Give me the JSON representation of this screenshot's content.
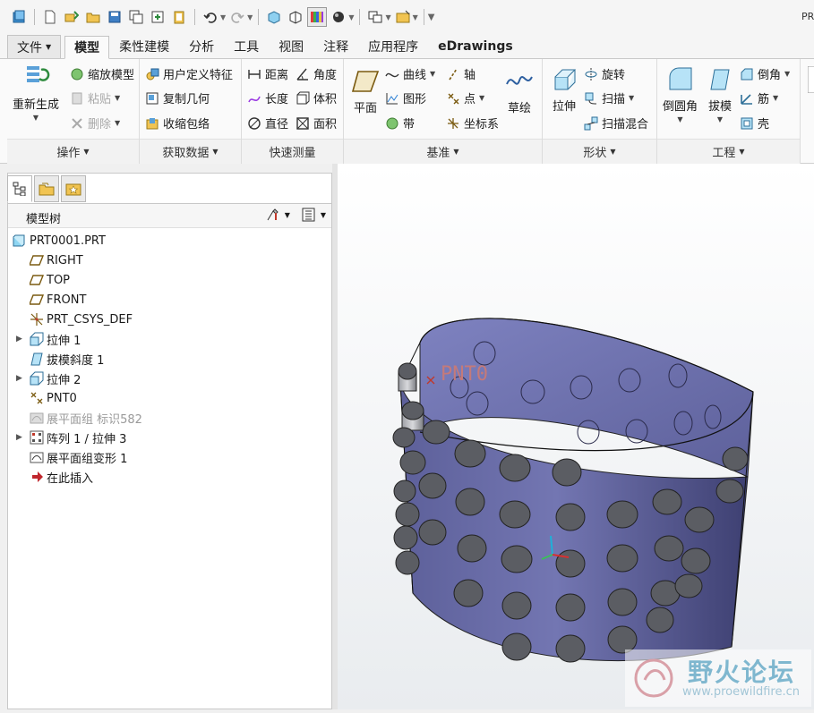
{
  "window": {
    "title_fragment": "PR"
  },
  "tabs": [
    {
      "label": "文件",
      "has_dropdown": true
    },
    {
      "label": "模型",
      "active": true
    },
    {
      "label": "柔性建模"
    },
    {
      "label": "分析"
    },
    {
      "label": "工具"
    },
    {
      "label": "视图"
    },
    {
      "label": "注释"
    },
    {
      "label": "应用程序"
    },
    {
      "label": "eDrawings"
    }
  ],
  "ribbon": {
    "operations": {
      "label": "操作",
      "regenerate": "重新生成",
      "zoom_model": "缩放模型",
      "paste": "粘贴",
      "delete": "删除"
    },
    "get_data": {
      "label": "获取数据",
      "udf": "用户定义特征",
      "copy_geom": "复制几何",
      "shrinkwrap": "收缩包络"
    },
    "measure": {
      "label": "快速测量",
      "distance": "距离",
      "angle": "角度",
      "length": "长度",
      "volume": "体积",
      "diameter": "直径",
      "area": "面积"
    },
    "datum": {
      "label": "基准",
      "plane": "平面",
      "curve": "曲线",
      "axis": "轴",
      "graph": "图形",
      "point": "点",
      "ribbon": "带",
      "csys": "坐标系",
      "sketch": "草绘"
    },
    "shapes": {
      "label": "形状",
      "extrude": "拉伸",
      "revolve": "旋转",
      "sweep": "扫描",
      "swept_blend": "扫描混合"
    },
    "engineering": {
      "label": "工程",
      "round": "倒圆角",
      "draft": "拔模",
      "chamfer": "倒角",
      "rib": "筋",
      "shell": "壳"
    }
  },
  "model_tree": {
    "title": "模型树",
    "items": [
      {
        "label": "PRT0001.PRT",
        "icon": "part-icon",
        "level": 0
      },
      {
        "label": "RIGHT",
        "icon": "datum-plane-icon",
        "level": 1
      },
      {
        "label": "TOP",
        "icon": "datum-plane-icon",
        "level": 1
      },
      {
        "label": "FRONT",
        "icon": "datum-plane-icon",
        "level": 1
      },
      {
        "label": "PRT_CSYS_DEF",
        "icon": "csys-icon",
        "level": 1
      },
      {
        "label": "拉伸 1",
        "icon": "extrude-icon",
        "level": 1,
        "expandable": true
      },
      {
        "label": "拔模斜度 1",
        "icon": "draft-icon",
        "level": 1
      },
      {
        "label": "拉伸 2",
        "icon": "extrude-icon",
        "level": 1,
        "expandable": true
      },
      {
        "label": "PNT0",
        "icon": "datum-point-icon",
        "level": 1
      },
      {
        "label": "展平面组 标识582",
        "icon": "flatten-icon",
        "level": 1,
        "dimmed": true
      },
      {
        "label": "阵列 1 / 拉伸 3",
        "icon": "pattern-icon",
        "level": 1,
        "expandable": true
      },
      {
        "label": "展平面组变形 1",
        "icon": "flatten-deform-icon",
        "level": 1
      },
      {
        "label": "在此插入",
        "icon": "insert-here-icon",
        "level": 1
      }
    ]
  },
  "viewport": {
    "point_label": "PNT0",
    "model_color": "#6b6ea8"
  },
  "watermark": {
    "title": "野火论坛",
    "url": "www.proewildfire.cn"
  },
  "colors": {
    "accent": "#2a7fd4",
    "ribbon_bg": "#fafafa",
    "selection_red": "#d83030"
  }
}
